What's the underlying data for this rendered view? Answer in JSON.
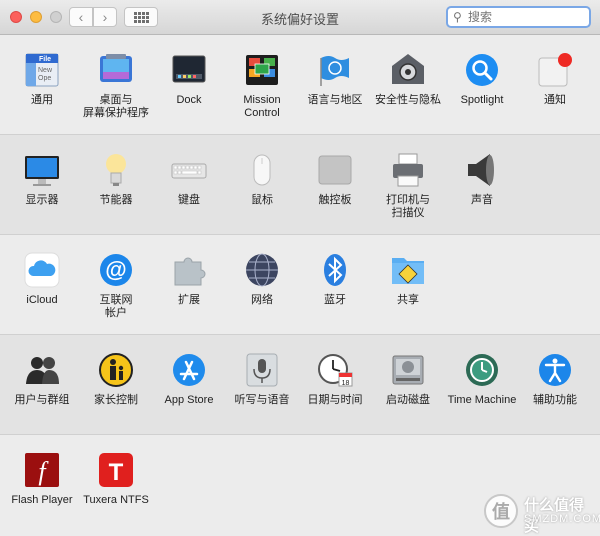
{
  "window": {
    "title": "系统偏好设置"
  },
  "search": {
    "placeholder": "搜索"
  },
  "rows": [
    [
      {
        "label": "通用",
        "icon": "general-icon"
      },
      {
        "label": "桌面与\n屏幕保护程序",
        "icon": "desktop-screensaver-icon"
      },
      {
        "label": "Dock",
        "icon": "dock-icon"
      },
      {
        "label": "Mission\nControl",
        "icon": "mission-control-icon"
      },
      {
        "label": "语言与地区",
        "icon": "language-region-icon"
      },
      {
        "label": "安全性与隐私",
        "icon": "security-privacy-icon"
      },
      {
        "label": "Spotlight",
        "icon": "spotlight-icon"
      },
      {
        "label": "通知",
        "icon": "notifications-icon"
      }
    ],
    [
      {
        "label": "显示器",
        "icon": "displays-icon"
      },
      {
        "label": "节能器",
        "icon": "energy-saver-icon"
      },
      {
        "label": "键盘",
        "icon": "keyboard-icon"
      },
      {
        "label": "鼠标",
        "icon": "mouse-icon"
      },
      {
        "label": "触控板",
        "icon": "trackpad-icon"
      },
      {
        "label": "打印机与\n扫描仪",
        "icon": "printers-scanners-icon"
      },
      {
        "label": "声音",
        "icon": "sound-icon"
      }
    ],
    [
      {
        "label": "iCloud",
        "icon": "icloud-icon"
      },
      {
        "label": "互联网\n帐户",
        "icon": "internet-accounts-icon"
      },
      {
        "label": "扩展",
        "icon": "extensions-icon"
      },
      {
        "label": "网络",
        "icon": "network-icon"
      },
      {
        "label": "蓝牙",
        "icon": "bluetooth-icon"
      },
      {
        "label": "共享",
        "icon": "sharing-icon"
      }
    ],
    [
      {
        "label": "用户与群组",
        "icon": "users-groups-icon"
      },
      {
        "label": "家长控制",
        "icon": "parental-controls-icon"
      },
      {
        "label": "App Store",
        "icon": "app-store-icon"
      },
      {
        "label": "听写与语音",
        "icon": "dictation-speech-icon"
      },
      {
        "label": "日期与时间",
        "icon": "date-time-icon"
      },
      {
        "label": "启动磁盘",
        "icon": "startup-disk-icon"
      },
      {
        "label": "Time Machine",
        "icon": "time-machine-icon"
      },
      {
        "label": "辅助功能",
        "icon": "accessibility-icon"
      }
    ],
    [
      {
        "label": "Flash Player",
        "icon": "flash-player-icon"
      },
      {
        "label": "Tuxera NTFS",
        "icon": "tuxera-ntfs-icon"
      }
    ]
  ],
  "icons_text": {
    "general_file": "File",
    "general_lines": [
      "New",
      "Ope"
    ],
    "calendar_day": "18",
    "flash_letter": "f",
    "tuxera_letter": "T"
  },
  "watermark": {
    "line1": "什么值得买",
    "line2": "SMZDM.COM",
    "mark": "值"
  }
}
